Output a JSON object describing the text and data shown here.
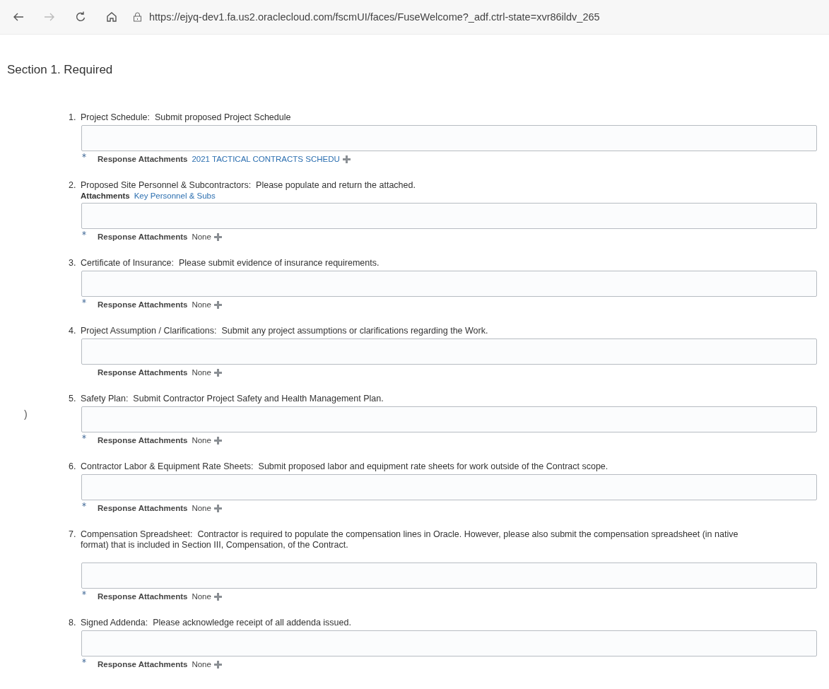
{
  "browser": {
    "url": "https://ejyq-dev1.fa.us2.oraclecloud.com/fscmUI/faces/FuseWelcome?_adf.ctrl-state=xvr86ildv_265"
  },
  "section": {
    "title": "Section 1. Required"
  },
  "edge_mark": ")",
  "items": [
    {
      "number": "1.",
      "label": "Project Schedule:",
      "description": "Submit proposed Project Schedule",
      "required": true,
      "response_label": "Response Attachments",
      "response_value": "2021 TACTICAL CONTRACTS SCHEDU",
      "response_linked": true
    },
    {
      "number": "2.",
      "label": "Proposed Site Personnel & Subcontractors:",
      "description": "Please populate and return the attached.",
      "attachments_label": "Attachments",
      "attachments_link": "Key Personnel & Subs",
      "required": true,
      "response_label": "Response Attachments",
      "response_value": "None",
      "response_linked": false
    },
    {
      "number": "3.",
      "label": "Certificate of Insurance:",
      "description": "Please submit evidence of insurance requirements.",
      "required": true,
      "response_label": "Response Attachments",
      "response_value": "None",
      "response_linked": false
    },
    {
      "number": "4.",
      "label": "Project Assumption / Clarifications:",
      "description": "Submit any project assumptions or clarifications regarding the Work.",
      "required": false,
      "response_label": "Response Attachments",
      "response_value": "None",
      "response_linked": false
    },
    {
      "number": "5.",
      "label": "Safety Plan:",
      "description": "Submit Contractor Project Safety and Health Management Plan.",
      "required": true,
      "response_label": "Response Attachments",
      "response_value": "None",
      "response_linked": false
    },
    {
      "number": "6.",
      "label": "Contractor Labor & Equipment Rate Sheets:",
      "description": "Submit proposed labor and equipment rate sheets for work outside of the Contract scope.",
      "required": true,
      "response_label": "Response Attachments",
      "response_value": "None",
      "response_linked": false
    },
    {
      "number": "7.",
      "label": "Compensation Spreadsheet:",
      "description": "Contractor is required to populate the compensation lines in Oracle.  However, please also submit the compensation spreadsheet (in native format) that is included in Section III, Compensation, of the Contract.",
      "required": true,
      "response_label": "Response Attachments",
      "response_value": "None",
      "response_linked": false
    },
    {
      "number": "8.",
      "label": "Signed Addenda:",
      "description": "Please acknowledge receipt of all addenda issued.",
      "required": true,
      "response_label": "Response Attachments",
      "response_value": "None",
      "response_linked": false
    }
  ]
}
